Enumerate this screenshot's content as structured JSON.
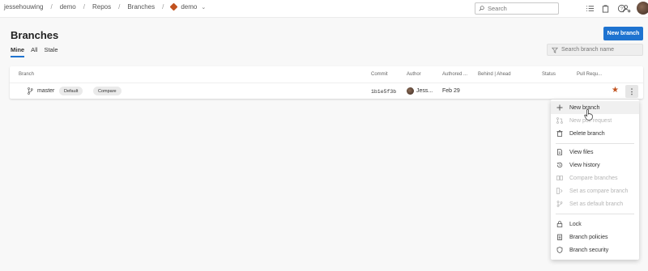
{
  "breadcrumb": {
    "org": "jessehouwing",
    "project": "demo",
    "section": "Repos",
    "page": "Branches",
    "repo": "demo"
  },
  "topbar": {
    "search_placeholder": "Search"
  },
  "header": {
    "title": "Branches",
    "new_branch_label": "New branch"
  },
  "pivots": [
    "Mine",
    "All",
    "Stale"
  ],
  "filter": {
    "placeholder": "Search branch name"
  },
  "table": {
    "columns": [
      "Branch",
      "Commit",
      "Author",
      "Authored ...",
      "Behind | Ahead",
      "Status",
      "Pull Requ..."
    ],
    "rows": [
      {
        "branch": "master",
        "badges": [
          "Default",
          "Compare"
        ],
        "commit": "1b1e5f3b",
        "author": "Jess...",
        "authored": "Feb 29",
        "starred": true
      }
    ]
  },
  "menu": {
    "items": [
      {
        "label": "New branch",
        "icon": "plus-icon",
        "disabled": false
      },
      {
        "label": "New pull request",
        "icon": "pull-request-icon",
        "disabled": true
      },
      {
        "label": "Delete branch",
        "icon": "trash-icon",
        "disabled": false
      },
      {
        "label": "View files",
        "icon": "file-icon",
        "disabled": false
      },
      {
        "label": "View history",
        "icon": "history-icon",
        "disabled": false
      },
      {
        "label": "Compare branches",
        "icon": "compare-icon",
        "disabled": true
      },
      {
        "label": "Set as compare branch",
        "icon": "compare-set-icon",
        "disabled": true
      },
      {
        "label": "Set as default branch",
        "icon": "branch-icon",
        "disabled": true
      },
      {
        "label": "Lock",
        "icon": "lock-icon",
        "disabled": false
      },
      {
        "label": "Branch policies",
        "icon": "policy-icon",
        "disabled": false
      },
      {
        "label": "Branch security",
        "icon": "shield-icon",
        "disabled": false
      }
    ]
  },
  "colors": {
    "accent": "#1e73d0",
    "star": "#c1521f",
    "repo_icon": "#c1521f"
  }
}
